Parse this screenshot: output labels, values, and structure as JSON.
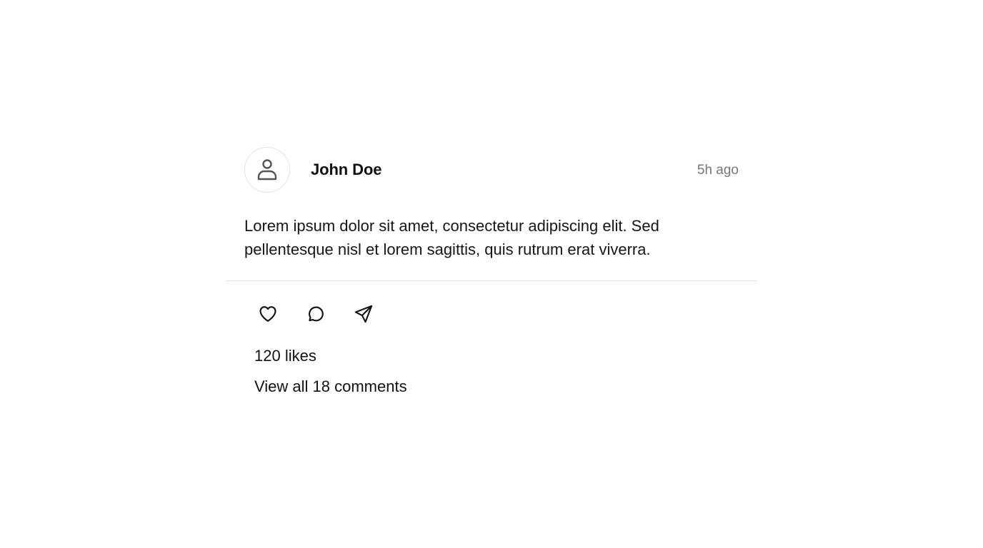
{
  "post": {
    "author": "John Doe",
    "timestamp": "5h ago",
    "avatar_icon": "user-icon",
    "body": "Lorem ipsum dolor sit amet, consectetur adipiscing elit. Sed pellentesque nisl et lorem sagittis, quis rutrum erat viverra.",
    "actions": {
      "like_icon": "heart-icon",
      "comment_icon": "comment-icon",
      "share_icon": "send-icon"
    },
    "likes_text": "120 likes",
    "comments_link_text": "View all 18 comments"
  },
  "colors": {
    "background": "#ffffff",
    "text": "#111111",
    "muted": "#777777",
    "border": "#e3e3e3",
    "icon": "#555555"
  }
}
